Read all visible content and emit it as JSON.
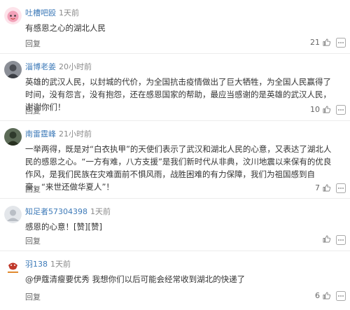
{
  "comments": [
    {
      "name": "吐槽吧殴",
      "time": "1天前",
      "text": "有感恩之心的湖北人民",
      "reply": "回复",
      "likes": "21",
      "avatar_color": "#f2a1b8"
    },
    {
      "name": "淄博老姜",
      "time": "20小时前",
      "text": "英雄的武汉人民，以封城的代价，为全国抗击疫情做出了巨大牺牲，为全国人民赢得了时间，没有怨言，没有抱怨，还在感恩国家的帮助，最应当感谢的是英雄的武汉人民，谢谢你们！",
      "reply": "回复",
      "likes": "10",
      "avatar_color": "#6b6f78"
    },
    {
      "name": "南雷霆峰",
      "time": "21小时前",
      "text": "一举两得，既是对“白衣执甲”的天使们表示了武汉和湖北人民的心意，又表达了湖北人民的感恩之心。“一方有难，八方支援”是我们新时代从非典，汶川地震以来保有的优良作风，是我们民族在灾难面前不惧风雨，战胜困难的有力保障，我们为祖国感到自豪，“来世还做华夏人”！",
      "reply": "回复",
      "likes": "7",
      "avatar_color": "#3a4a3a"
    },
    {
      "name": "知足者57304398",
      "time": "1天前",
      "text": "感恩的心意！[赞][赞]",
      "reply": "回复",
      "likes": "",
      "avatar_color": "#cfd3d8"
    },
    {
      "name": "羽138",
      "time": "1天前",
      "text": "@伊蔻清瘦要优秀 我想你们以后可能会经常收到湖北的快递了",
      "reply": "回复",
      "likes": "6",
      "avatar_color": "#ffffff"
    }
  ]
}
